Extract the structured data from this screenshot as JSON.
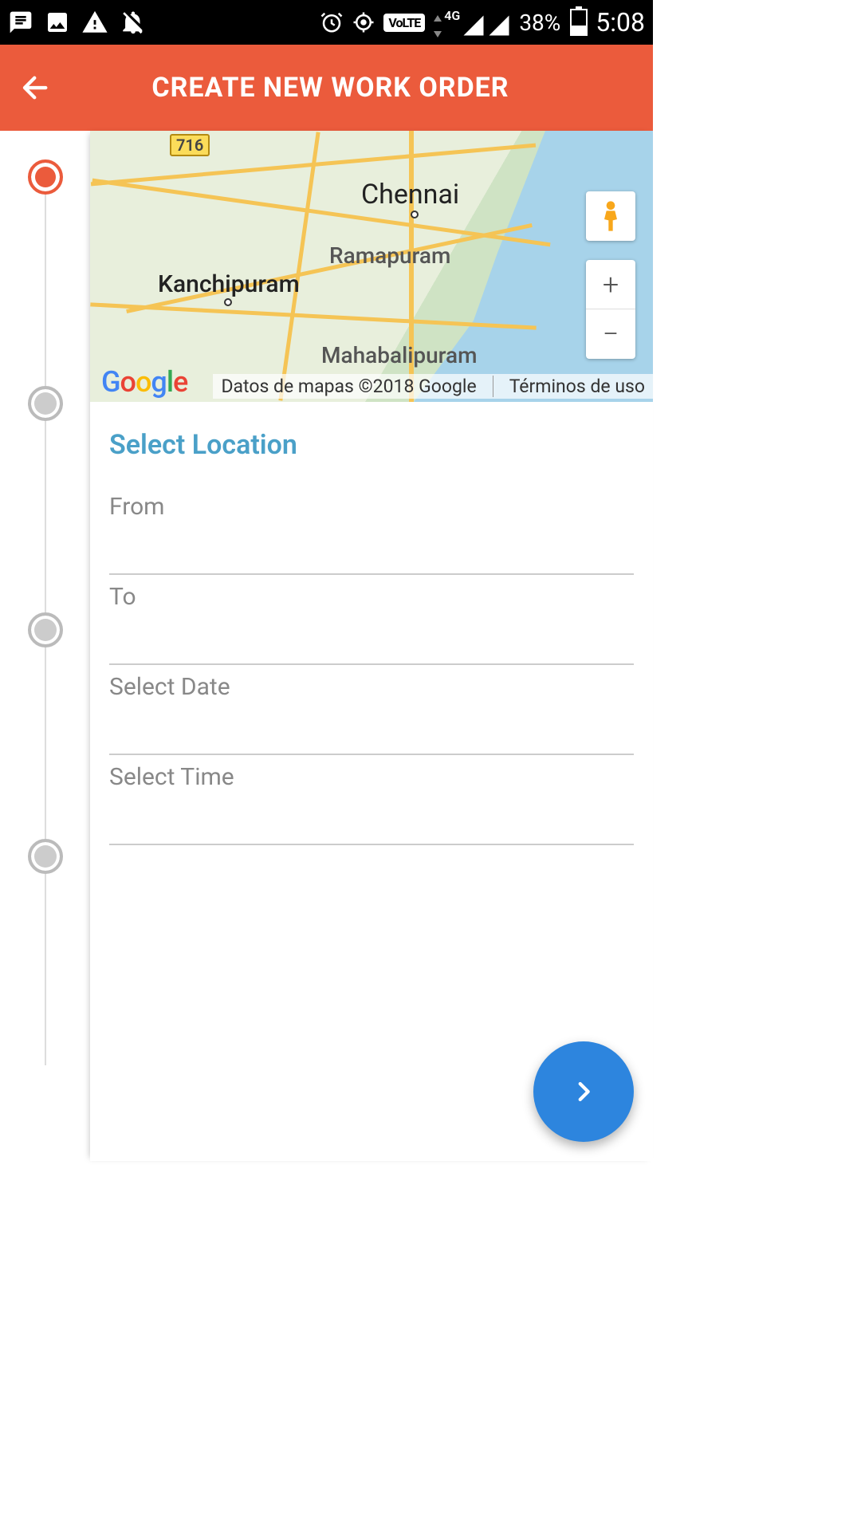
{
  "status_bar": {
    "battery_percent": "38%",
    "time": "5:08",
    "network_label": "4G",
    "volte": "VoLTE"
  },
  "header": {
    "title": "CREATE NEW WORK ORDER"
  },
  "map": {
    "route_badge": "716",
    "cities": {
      "chennai": "Chennai",
      "ramapuram": "Ramapuram",
      "kanchipuram": "Kanchipuram",
      "mahabalipuram": "Mahabalipuram"
    },
    "attribution": "Datos de mapas ©2018 Google",
    "terms": "Términos de uso",
    "logo_letters": [
      "G",
      "o",
      "o",
      "g",
      "l",
      "e"
    ],
    "zoom_in_glyph": "+",
    "zoom_out_glyph": "−"
  },
  "form": {
    "section_title": "Select Location",
    "fields": {
      "from": {
        "label": "From",
        "value": ""
      },
      "to": {
        "label": "To",
        "value": ""
      },
      "date": {
        "label": "Select Date",
        "value": ""
      },
      "time": {
        "label": "Select Time",
        "value": ""
      }
    }
  },
  "stepper": {
    "steps": 4,
    "active_index": 0
  },
  "colors": {
    "accent": "#EB5B3C",
    "fab": "#2d85de",
    "section_title": "#4aa0c8"
  }
}
